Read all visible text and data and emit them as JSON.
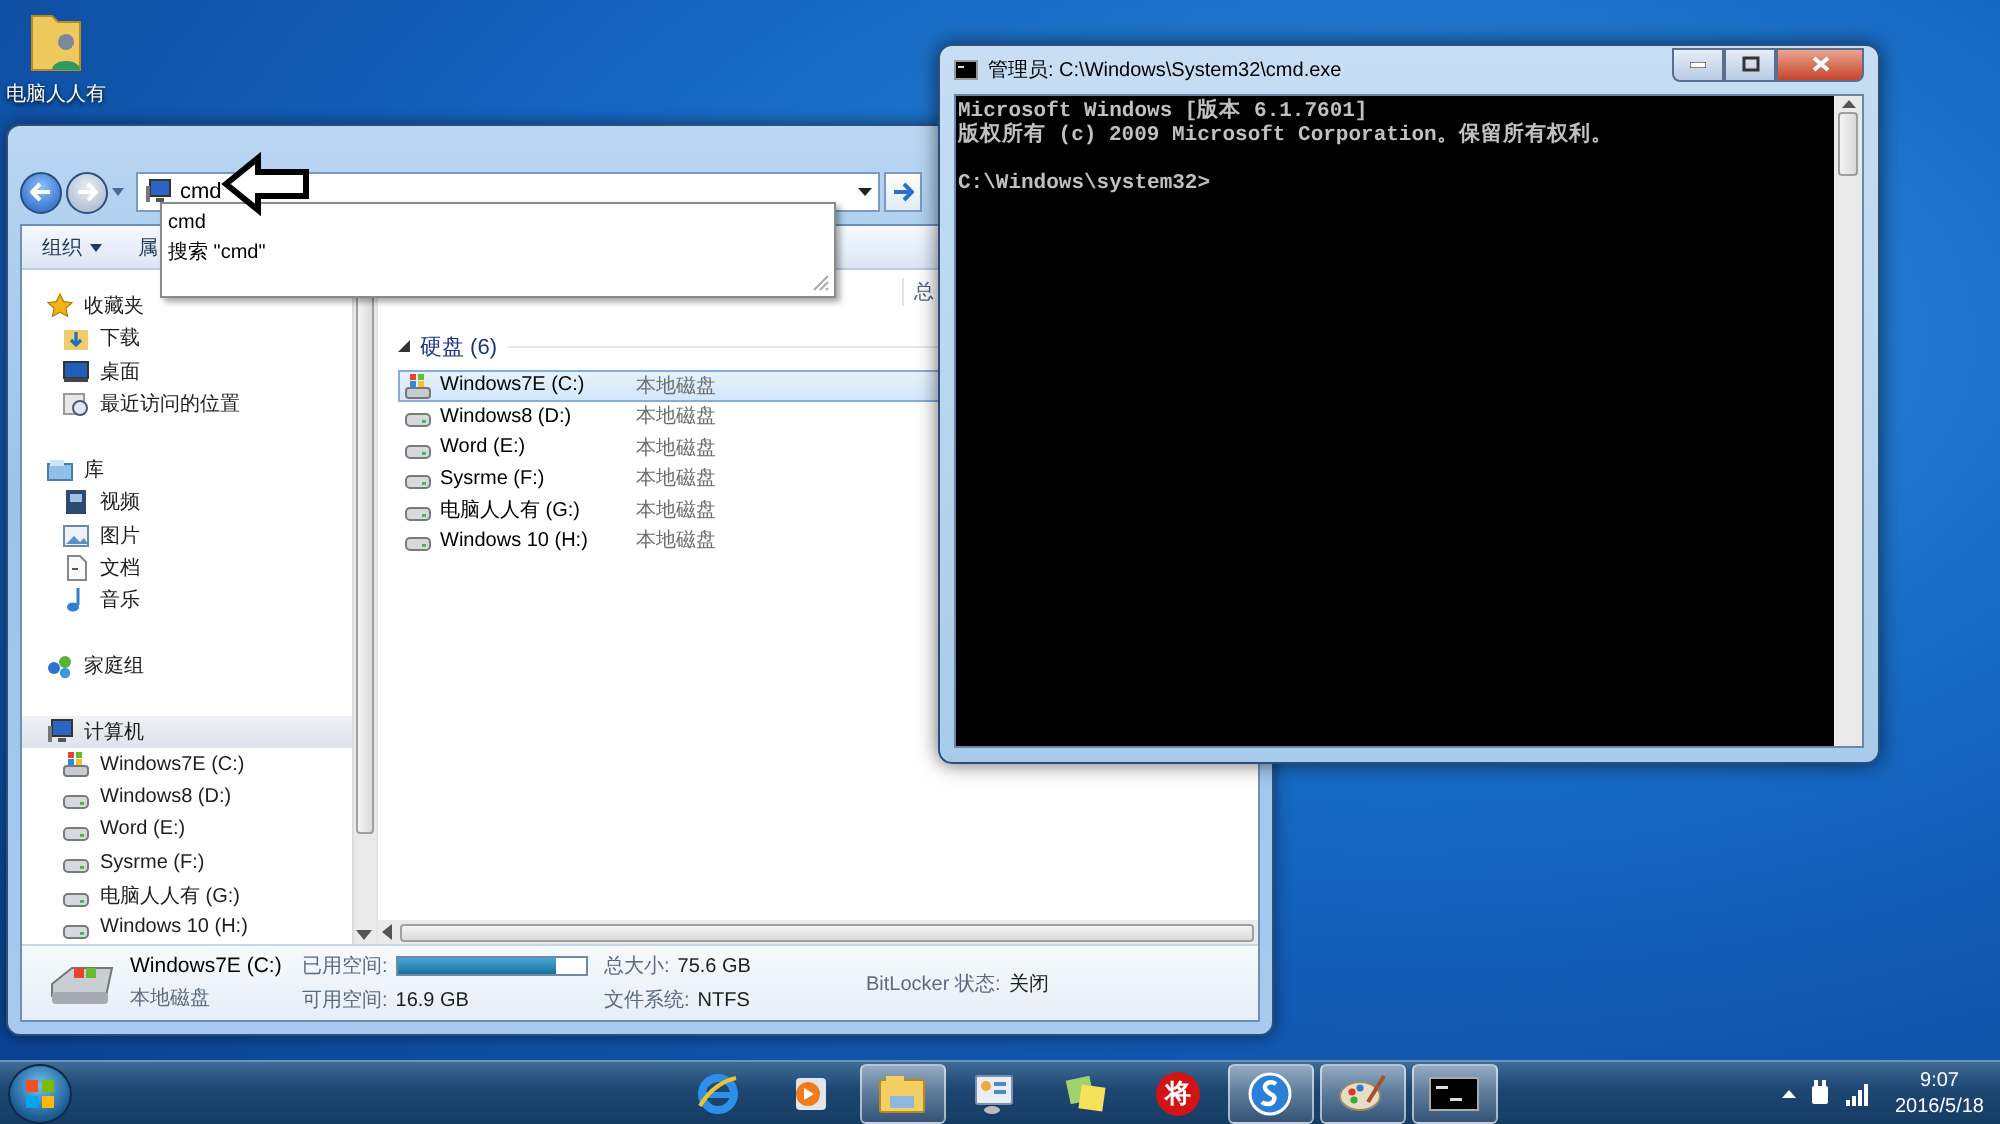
{
  "desktop_icons": [
    {
      "label": "电脑人人有"
    }
  ],
  "explorer": {
    "address": {
      "value": "cmd"
    },
    "suggestions": [
      "cmd",
      "搜索 \"cmd\""
    ],
    "toolbar": [
      {
        "label": "组织",
        "dropdown": true
      },
      {
        "label": "属",
        "dropdown": false
      }
    ],
    "column_header": "总",
    "nav": [
      {
        "label": "收藏夹",
        "kind": "star",
        "selected": false,
        "children": [
          {
            "label": "下载",
            "kind": "download",
            "selected": false
          },
          {
            "label": "桌面",
            "kind": "desktop",
            "selected": false
          },
          {
            "label": "最近访问的位置",
            "kind": "recent",
            "selected": false
          }
        ]
      },
      {
        "label": "库",
        "kind": "library",
        "selected": false,
        "children": [
          {
            "label": "视频",
            "kind": "video",
            "selected": false
          },
          {
            "label": "图片",
            "kind": "picture",
            "selected": false
          },
          {
            "label": "文档",
            "kind": "document",
            "selected": false
          },
          {
            "label": "音乐",
            "kind": "music",
            "selected": false
          }
        ]
      },
      {
        "label": "家庭组",
        "kind": "homegroup",
        "selected": false
      },
      {
        "label": "计算机",
        "kind": "computer",
        "selected": true,
        "children": [
          {
            "label": "Windows7E (C:)",
            "kind": "system-drive",
            "selected": false
          },
          {
            "label": "Windows8 (D:)",
            "kind": "drive",
            "selected": false
          },
          {
            "label": "Word (E:)",
            "kind": "drive",
            "selected": false
          },
          {
            "label": "Sysrme (F:)",
            "kind": "drive",
            "selected": false
          },
          {
            "label": "电脑人人有 (G:)",
            "kind": "drive",
            "selected": false
          },
          {
            "label": "Windows 10 (H:)",
            "kind": "drive",
            "selected": false
          }
        ]
      }
    ],
    "group": {
      "title": "硬盘 (6)",
      "expanded": true
    },
    "drives": [
      {
        "name": "Windows7E (C:)",
        "type": "本地磁盘",
        "kind": "system-drive",
        "selected": true
      },
      {
        "name": "Windows8 (D:)",
        "type": "本地磁盘",
        "kind": "drive",
        "selected": false
      },
      {
        "name": "Word (E:)",
        "type": "本地磁盘",
        "kind": "drive",
        "selected": false
      },
      {
        "name": "Sysrme (F:)",
        "type": "本地磁盘",
        "kind": "drive",
        "selected": false
      },
      {
        "name": "电脑人人有 (G:)",
        "type": "本地磁盘",
        "kind": "drive",
        "selected": false
      },
      {
        "name": "Windows 10 (H:)",
        "type": "本地磁盘",
        "kind": "drive",
        "selected": false
      }
    ],
    "details": {
      "name": "Windows7E (C:)",
      "type": "本地磁盘",
      "used_label": "已用空间:",
      "level": 0.84,
      "free_label": "可用空间:",
      "free": "16.9 GB",
      "total_label": "总大小:",
      "total": "75.6 GB",
      "fs_label": "文件系统:",
      "fs": "NTFS",
      "bitlocker_label": "BitLocker 状态:",
      "bitlocker": "关闭"
    }
  },
  "cmd": {
    "title": "管理员: C:\\Windows\\System32\\cmd.exe",
    "lines": [
      {
        "text": "Microsoft Windows [版本 6.1.7601]",
        "gap": false
      },
      {
        "text": "版权所有 (c) 2009 Microsoft Corporation。保留所有权利。",
        "gap": false
      },
      {
        "text": "C:\\Windows\\system32>",
        "gap": true
      }
    ]
  },
  "taskbar": {
    "apps": [
      {
        "kind": "browser",
        "active": false
      },
      {
        "kind": "media",
        "active": false
      },
      {
        "kind": "folder",
        "active": true
      },
      {
        "kind": "device",
        "active": false
      },
      {
        "kind": "notes",
        "active": false
      },
      {
        "kind": "glyph",
        "glyph": "将",
        "active": false
      },
      {
        "kind": "swirl",
        "active": true
      },
      {
        "kind": "paint",
        "active": true
      },
      {
        "kind": "console",
        "active": true
      }
    ],
    "clock": {
      "time": "9:07",
      "date": "2016/5/18"
    }
  }
}
